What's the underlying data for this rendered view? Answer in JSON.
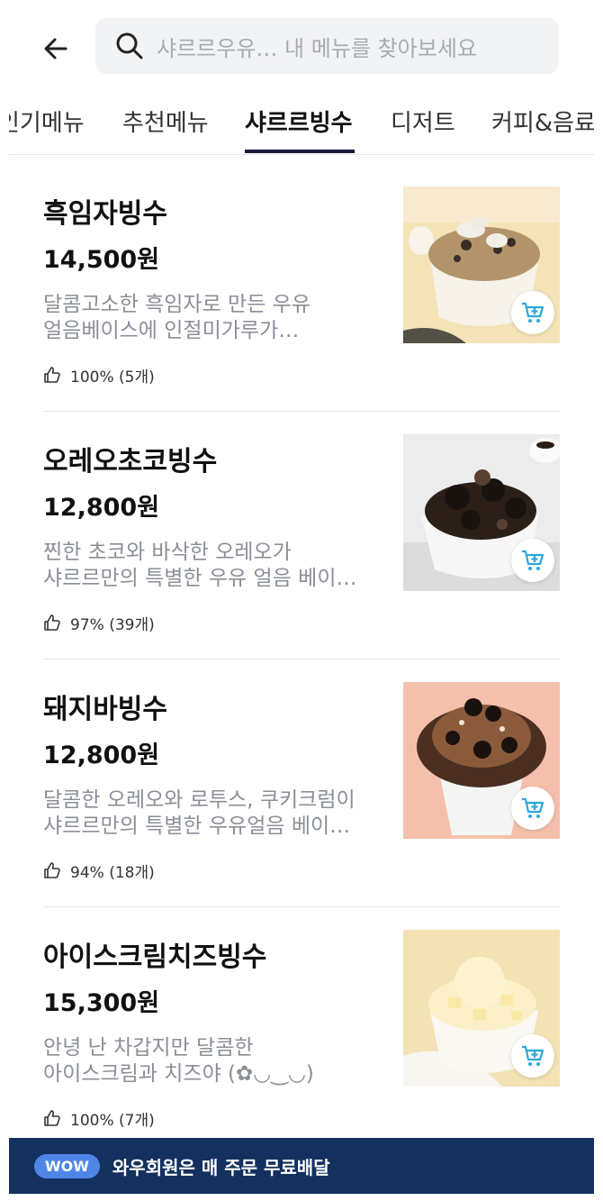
{
  "header": {
    "search_placeholder": "샤르르우유… 내 메뉴를 찾아보세요"
  },
  "tabs": [
    {
      "label": "인기메뉴"
    },
    {
      "label": "추천메뉴"
    },
    {
      "label": "샤르르빙수"
    },
    {
      "label": "디저트"
    },
    {
      "label": "커피&음료"
    }
  ],
  "items": [
    {
      "name": "흑임자빙수",
      "price": "14,500원",
      "desc_line1": "달콤고소한 흑임자로 만든 우유",
      "desc_line2": "얼음베이스에 인절미가루가…",
      "rating": "100% (5개)"
    },
    {
      "name": "오레오초코빙수",
      "price": "12,800원",
      "desc_line1": "찐한 초코와 바삭한 오레오가",
      "desc_line2": "샤르르만의 특별한 우유 얼음 베이…",
      "rating": "97% (39개)"
    },
    {
      "name": "돼지바빙수",
      "price": "12,800원",
      "desc_line1": "달콤한 오레오와 로투스, 쿠키크럼이",
      "desc_line2": "샤르르만의 특별한 우유얼음 베이…",
      "rating": "94% (18개)"
    },
    {
      "name": "아이스크림치즈빙수",
      "price": "15,300원",
      "desc_line1": "안녕 난 차갑지만 달콤한",
      "desc_line2": "아이스크림과 치즈야 (✿◡‿◡)",
      "rating": "100% (7개)"
    }
  ],
  "banner": {
    "badge": "WOW",
    "text": "와우회원은 매 주문 무료배달"
  },
  "colors": {
    "brand_navy": "#13305e",
    "accent_blue": "#4f86e6",
    "cart_icon": "#2aa8d8"
  }
}
